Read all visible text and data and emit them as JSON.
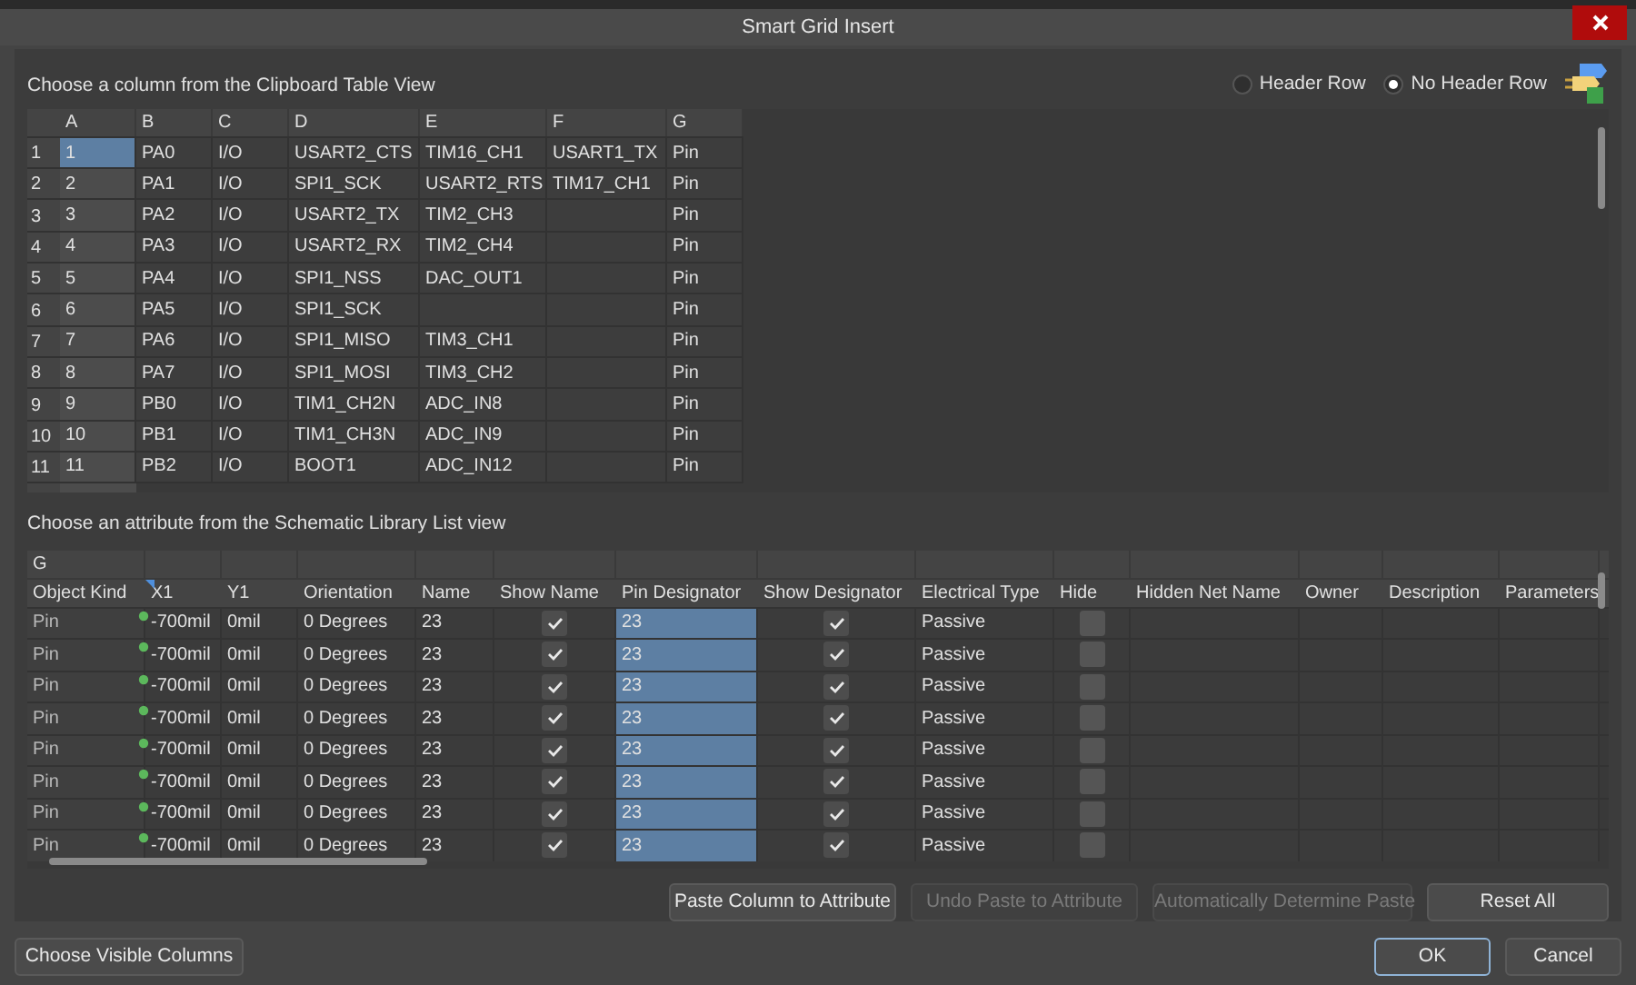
{
  "window": {
    "title": "Smart Grid Insert"
  },
  "clipboard": {
    "label": "Choose a column from the Clipboard Table View",
    "header_options": [
      {
        "label": "Header Row",
        "selected": false
      },
      {
        "label": "No Header Row",
        "selected": true
      }
    ],
    "columns": [
      {
        "label": "A",
        "selected": true
      },
      {
        "label": "B",
        "selected": false
      },
      {
        "label": "C",
        "selected": false
      },
      {
        "label": "D",
        "selected": false
      },
      {
        "label": "E",
        "selected": false
      },
      {
        "label": "F",
        "selected": false
      },
      {
        "label": "G",
        "selected": false
      }
    ],
    "rows": [
      {
        "number": "1",
        "cells": [
          "1",
          "PA0",
          "I/O",
          "USART2_CTS",
          "TIM16_CH1",
          "USART1_TX",
          "Pin"
        ]
      },
      {
        "number": "2",
        "cells": [
          "2",
          "PA1",
          "I/O",
          "SPI1_SCK",
          "USART2_RTS",
          "TIM17_CH1",
          "Pin"
        ]
      },
      {
        "number": "3",
        "cells": [
          "3",
          "PA2",
          "I/O",
          "USART2_TX",
          "TIM2_CH3",
          "",
          "Pin"
        ]
      },
      {
        "number": "4",
        "cells": [
          "4",
          "PA3",
          "I/O",
          "USART2_RX",
          "TIM2_CH4",
          "",
          "Pin"
        ]
      },
      {
        "number": "5",
        "cells": [
          "5",
          "PA4",
          "I/O",
          "SPI1_NSS",
          "DAC_OUT1",
          "",
          "Pin"
        ]
      },
      {
        "number": "6",
        "cells": [
          "6",
          "PA5",
          "I/O",
          "SPI1_SCK",
          "",
          "",
          "Pin"
        ]
      },
      {
        "number": "7",
        "cells": [
          "7",
          "PA6",
          "I/O",
          "SPI1_MISO",
          "TIM3_CH1",
          "",
          "Pin"
        ]
      },
      {
        "number": "8",
        "cells": [
          "8",
          "PA7",
          "I/O",
          "SPI1_MOSI",
          "TIM3_CH2",
          "",
          "Pin"
        ]
      },
      {
        "number": "9",
        "cells": [
          "9",
          "PB0",
          "I/O",
          "TIM1_CH2N",
          "ADC_IN8",
          "",
          "Pin"
        ]
      },
      {
        "number": "10",
        "cells": [
          "10",
          "PB1",
          "I/O",
          "TIM1_CH3N",
          "ADC_IN9",
          "",
          "Pin"
        ]
      },
      {
        "number": "11",
        "cells": [
          "11",
          "PB2",
          "I/O",
          "BOOT1",
          "ADC_IN12",
          "",
          "Pin"
        ]
      }
    ]
  },
  "attributes": {
    "label": "Choose an attribute from the Schematic Library List view",
    "group_header": "G",
    "columns": [
      {
        "label": "Object Kind",
        "kind": "text",
        "selected": false
      },
      {
        "label": "X1",
        "kind": "text",
        "selected": false
      },
      {
        "label": "Y1",
        "kind": "text",
        "selected": false
      },
      {
        "label": "Orientation",
        "kind": "text",
        "selected": false
      },
      {
        "label": "Name",
        "kind": "text",
        "selected": false
      },
      {
        "label": "Show Name",
        "kind": "check",
        "selected": false
      },
      {
        "label": "Pin Designator",
        "kind": "text",
        "selected": true
      },
      {
        "label": "Show Designator",
        "kind": "check",
        "selected": false
      },
      {
        "label": "Electrical Type",
        "kind": "text",
        "selected": false
      },
      {
        "label": "Hide",
        "kind": "check",
        "selected": false
      },
      {
        "label": "Hidden Net Name",
        "kind": "text",
        "selected": false
      },
      {
        "label": "Owner",
        "kind": "text",
        "selected": false
      },
      {
        "label": "Description",
        "kind": "text",
        "selected": false
      },
      {
        "label": "Parameters",
        "kind": "text",
        "selected": false
      }
    ],
    "rows": [
      {
        "cells": [
          "Pin",
          "-700mil",
          "0mil",
          "0 Degrees",
          "23",
          true,
          "23",
          true,
          "Passive",
          false,
          "",
          "",
          "",
          ""
        ]
      },
      {
        "cells": [
          "Pin",
          "-700mil",
          "0mil",
          "0 Degrees",
          "23",
          true,
          "23",
          true,
          "Passive",
          false,
          "",
          "",
          "",
          ""
        ]
      },
      {
        "cells": [
          "Pin",
          "-700mil",
          "0mil",
          "0 Degrees",
          "23",
          true,
          "23",
          true,
          "Passive",
          false,
          "",
          "",
          "",
          ""
        ]
      },
      {
        "cells": [
          "Pin",
          "-700mil",
          "0mil",
          "0 Degrees",
          "23",
          true,
          "23",
          true,
          "Passive",
          false,
          "",
          "",
          "",
          ""
        ]
      },
      {
        "cells": [
          "Pin",
          "-700mil",
          "0mil",
          "0 Degrees",
          "23",
          true,
          "23",
          true,
          "Passive",
          false,
          "",
          "",
          "",
          ""
        ]
      },
      {
        "cells": [
          "Pin",
          "-700mil",
          "0mil",
          "0 Degrees",
          "23",
          true,
          "23",
          true,
          "Passive",
          false,
          "",
          "",
          "",
          ""
        ]
      },
      {
        "cells": [
          "Pin",
          "-700mil",
          "0mil",
          "0 Degrees",
          "23",
          true,
          "23",
          true,
          "Passive",
          false,
          "",
          "",
          "",
          ""
        ]
      },
      {
        "cells": [
          "Pin",
          "-700mil",
          "0mil",
          "0 Degrees",
          "23",
          true,
          "23",
          true,
          "Passive",
          false,
          "",
          "",
          "",
          ""
        ]
      }
    ]
  },
  "actions": [
    {
      "label": "Paste Column to Attribute",
      "disabled": false
    },
    {
      "label": "Undo Paste to Attribute",
      "disabled": true
    },
    {
      "label": "Automatically Determine Paste",
      "disabled": true
    },
    {
      "label": "Reset All",
      "disabled": false
    }
  ],
  "footer": {
    "left_button": "Choose Visible Columns",
    "buttons": [
      {
        "label": "OK",
        "default": true
      },
      {
        "label": "Cancel",
        "default": false
      }
    ]
  }
}
